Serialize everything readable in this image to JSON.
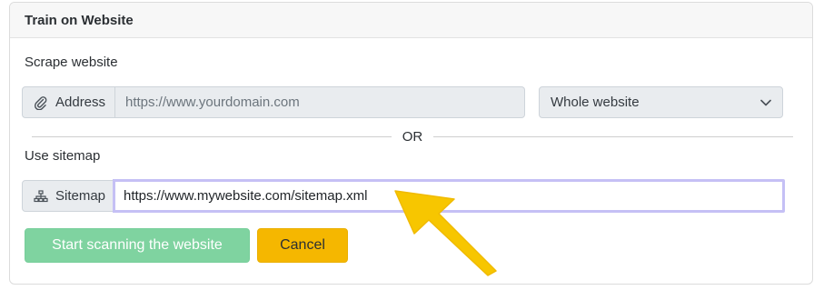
{
  "card": {
    "title": "Train on Website"
  },
  "scrape": {
    "label": "Scrape website",
    "address_addon": "Address",
    "address_placeholder": "https://www.yourdomain.com",
    "scope_selected": "Whole website"
  },
  "divider": {
    "text": "OR"
  },
  "sitemap": {
    "label": "Use sitemap",
    "addon": "Sitemap",
    "value": "https://www.mywebsite.com/sitemap.xml"
  },
  "buttons": {
    "start_label": "Start scanning the website",
    "cancel_label": "Cancel"
  },
  "colors": {
    "start_button": "#7fd3a0",
    "cancel_button": "#f5b700",
    "focus_ring": "#c5c0f5",
    "arrow": "#f7c600"
  },
  "icons": {
    "address": "paperclip-icon",
    "sitemap": "sitemap-icon",
    "select": "chevron-down-icon",
    "pointer": "arrow-pointer-annotation"
  }
}
